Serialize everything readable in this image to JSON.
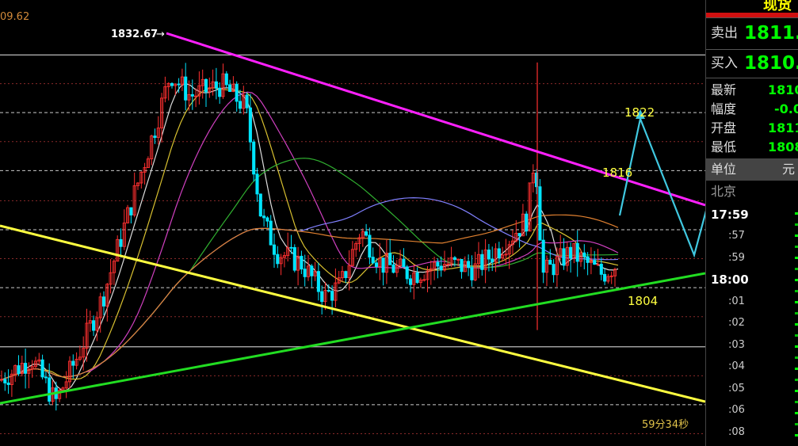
{
  "header_left_value": "09.62",
  "header_buttons": [
    "",
    ""
  ],
  "colors": {
    "up_candle": "#ff3030",
    "down_candle": "#00e5ff",
    "trend_upper": "#ff20ff",
    "trend_support": "#22dd22",
    "trend_yellow": "#ffff40",
    "forecast": "#40c8e0"
  },
  "annotations": {
    "high_label": "1832.67",
    "target_1822": "1822",
    "target_1816": "1816",
    "target_1804": "1804",
    "countdown": "59分34秒"
  },
  "chart_data": {
    "type": "candlestick",
    "ylim": [
      1797.6,
      1837.6
    ],
    "reference_levels": [
      1832.67,
      1830.1,
      1827.5,
      1824.9,
      1822.3,
      1819.6,
      1817.0,
      1814.4,
      1811.8,
      1809.2,
      1806.5,
      1803.9,
      1801.3,
      1798.7
    ],
    "grid": true
  },
  "panel": {
    "title": "现货",
    "sell_label": "卖出",
    "sell_value": "1811.",
    "buy_label": "买入",
    "buy_value": "1810.",
    "rows": [
      {
        "label": "最新",
        "value": "1810"
      },
      {
        "label": "幅度",
        "value": "-0.0"
      },
      {
        "label": "开盘",
        "value": "1811"
      },
      {
        "label": "最低",
        "value": "1808"
      }
    ],
    "unit_label": "单位",
    "unit_value": "元",
    "location": "北京",
    "times": [
      {
        "label": "17:59",
        "bold": true
      },
      {
        "label": ":57",
        "bold": false
      },
      {
        "label": ":59",
        "bold": false
      },
      {
        "label": "18:00",
        "bold": true
      },
      {
        "label": ":01",
        "bold": false
      },
      {
        "label": ":02",
        "bold": false
      },
      {
        "label": ":03",
        "bold": false
      },
      {
        "label": ":04",
        "bold": false
      },
      {
        "label": ":05",
        "bold": false
      },
      {
        "label": ":06",
        "bold": false
      },
      {
        "label": ":08",
        "bold": false
      }
    ]
  }
}
